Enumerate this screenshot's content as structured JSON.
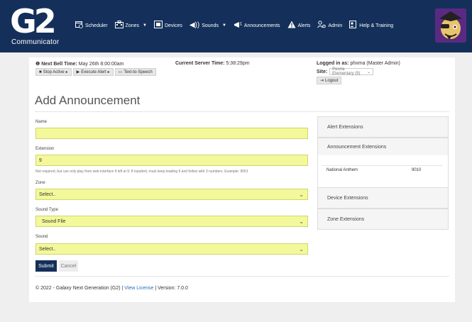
{
  "app": {
    "logo_text": "G2",
    "logo_sub": "Communicator"
  },
  "nav": {
    "items": [
      {
        "label": "Scheduler",
        "icon": "calendar-clock-icon",
        "dropdown": false
      },
      {
        "label": "Zones",
        "icon": "building-icon",
        "dropdown": true
      },
      {
        "label": "Devices",
        "icon": "devices-icon",
        "dropdown": false
      },
      {
        "label": "Sounds",
        "icon": "speaker-icon",
        "dropdown": true
      },
      {
        "label": "Announcements",
        "icon": "megaphone-icon",
        "dropdown": false
      },
      {
        "label": "Alerts",
        "icon": "warning-icon",
        "dropdown": false
      },
      {
        "label": "Admin",
        "icon": "users-cog-icon",
        "dropdown": false
      },
      {
        "label": "Help & Training",
        "icon": "help-book-icon",
        "dropdown": false
      }
    ]
  },
  "status": {
    "next_bell_label": "Next Bell Time:",
    "next_bell_value": "May 26th 8:00:00am",
    "server_time_label": "Current Server Time:",
    "server_time_value": "5:38:29pm",
    "logged_in_label": "Logged in as:",
    "logged_in_value": "phxma (Master Admin)",
    "site_label": "Site:",
    "site_value": "Peoria Elementary (9)",
    "buttons": {
      "stop_active": "Stop Active",
      "execute_alert": "Execute Alert",
      "tts": "Text-to-Speech"
    },
    "logout": "Logout"
  },
  "page": {
    "title": "Add Announcement"
  },
  "form": {
    "name_label": "Name",
    "name_value": "",
    "extension_label": "Extension",
    "extension_value": "9",
    "extension_hint": "Not required, but can only play from web interface if left at 9. If inputted, must keep leading 9 and follow with 3 numbers. Example: 9001",
    "zone_label": "Zone",
    "zone_value": "Select..",
    "sound_type_label": "Sound Type",
    "sound_type_value": "Sound File",
    "sound_label": "Sound",
    "sound_value": "Select..",
    "submit": "Submit",
    "cancel": "Cancel"
  },
  "sidebar": {
    "alert_ext": "Alert Extensions",
    "announcement_ext": "Announcement Extensions",
    "announcement_rows": [
      {
        "name": "National Anthem",
        "ext": "9010"
      }
    ],
    "device_ext": "Device Extensions",
    "zone_ext": "Zone Extensions"
  },
  "footer": {
    "copyright": "© 2022 - Galaxy Next Generation (G2) |",
    "license_link": "View License",
    "version": "| Version: 7.0.0"
  },
  "colors": {
    "nav_bg": "#14305a",
    "field_bg": "#f3f99b",
    "submit_bg": "#14305a",
    "link": "#2a6ebb"
  }
}
